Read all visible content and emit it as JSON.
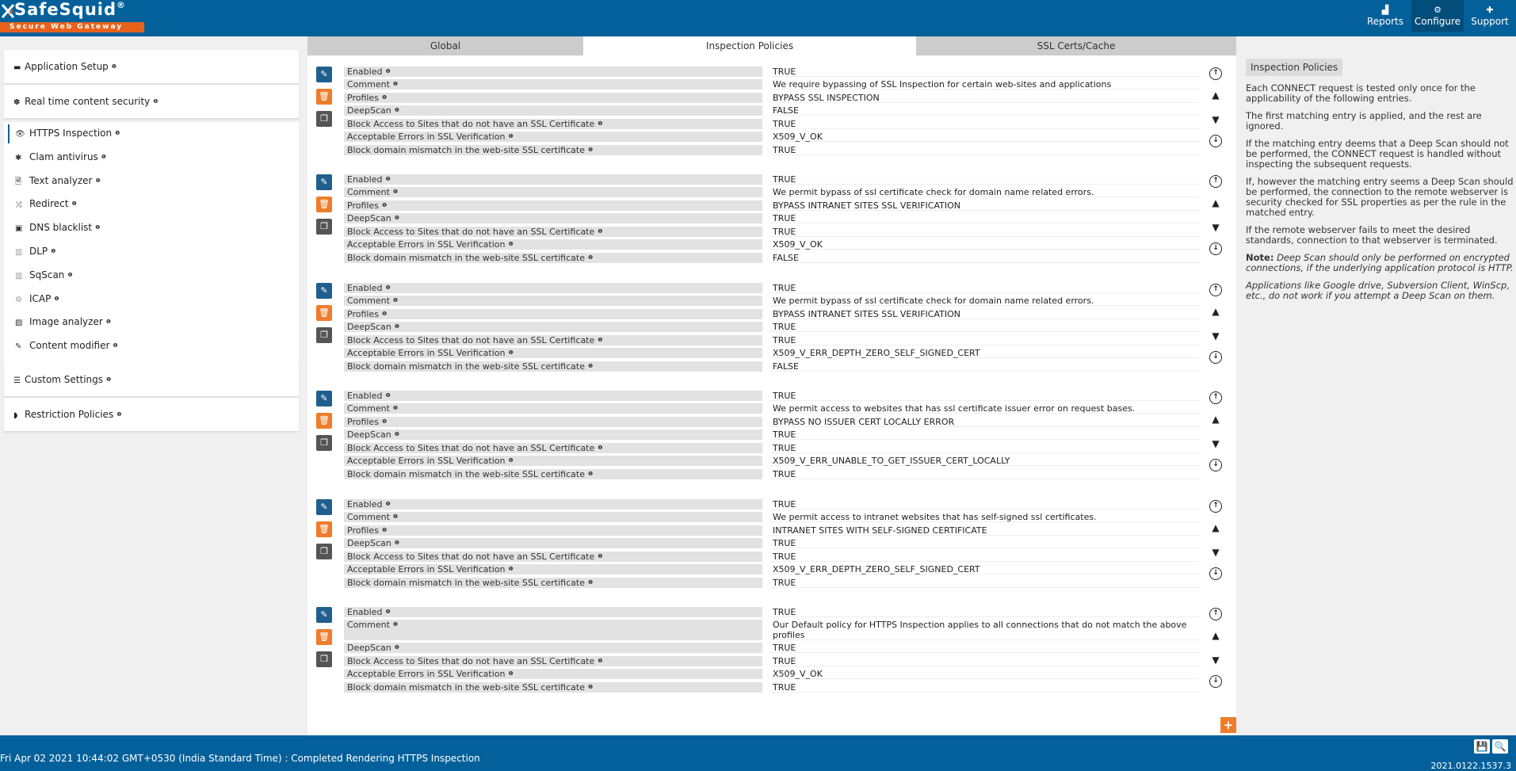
{
  "header": {
    "brand": "SafeSquid",
    "reg": "®",
    "tagline": "Secure Web Gateway",
    "nav": [
      {
        "label": "Reports",
        "icon": "reports-icon"
      },
      {
        "label": "Configure",
        "icon": "configure-icon"
      },
      {
        "label": "Support",
        "icon": "support-icon"
      }
    ]
  },
  "sidebar": {
    "app_setup": "Application Setup",
    "realtime": "Real time content security",
    "items": [
      {
        "label": "HTTPS Inspection",
        "glyph": "👁"
      },
      {
        "label": "Clam antivirus",
        "glyph": "✱"
      },
      {
        "label": "Text analyzer",
        "glyph": "🗎"
      },
      {
        "label": "Redirect",
        "glyph": "⤨"
      },
      {
        "label": "DNS blacklist",
        "glyph": "▣"
      },
      {
        "label": "DLP",
        "glyph": "▥"
      },
      {
        "label": "SqScan",
        "glyph": "▥"
      },
      {
        "label": "ICAP",
        "glyph": "⚙"
      },
      {
        "label": "Image analyzer",
        "glyph": "▨"
      },
      {
        "label": "Content modifier",
        "glyph": "✎"
      }
    ],
    "custom": "Custom Settings",
    "restriction": "Restriction Policies"
  },
  "tabs": [
    "Global",
    "Inspection Policies",
    "SSL Certs/Cache"
  ],
  "labels": {
    "enabled": "Enabled",
    "comment": "Comment",
    "profiles": "Profiles",
    "deepscan": "DeepScan",
    "block_no_ssl": "Block Access to Sites that do not have an SSL Certificate",
    "acceptable": "Acceptable Errors in SSL Verification",
    "mismatch": "Block domain mismatch in the web-site SSL certificate"
  },
  "entries": [
    {
      "enabled": "TRUE",
      "comment": "We require bypassing of SSL Inspection for certain web-sites and applications",
      "profiles": "BYPASS SSL INSPECTION",
      "deepscan": "FALSE",
      "block_no_ssl": "TRUE",
      "acceptable": "X509_V_OK",
      "mismatch": "TRUE"
    },
    {
      "enabled": "TRUE",
      "comment": "We permit bypass of ssl certificate check for domain name related errors.",
      "profiles": "BYPASS INTRANET SITES SSL VERIFICATION",
      "deepscan": "TRUE",
      "block_no_ssl": "TRUE",
      "acceptable": "X509_V_OK",
      "mismatch": "FALSE"
    },
    {
      "enabled": "TRUE",
      "comment": "We permit bypass of ssl certificate check for domain name related errors.",
      "profiles": "BYPASS INTRANET SITES SSL VERIFICATION",
      "deepscan": "TRUE",
      "block_no_ssl": "TRUE",
      "acceptable": "X509_V_ERR_DEPTH_ZERO_SELF_SIGNED_CERT",
      "mismatch": "FALSE"
    },
    {
      "enabled": "TRUE",
      "comment": "We permit access to websites that has ssl certificate issuer error on request bases.",
      "profiles": "BYPASS NO ISSUER CERT LOCALLY ERROR",
      "deepscan": "TRUE",
      "block_no_ssl": "TRUE",
      "acceptable": "X509_V_ERR_UNABLE_TO_GET_ISSUER_CERT_LOCALLY",
      "mismatch": "TRUE"
    },
    {
      "enabled": "TRUE",
      "comment": "We permit access to intranet websites that has self-signed ssl certificates.",
      "profiles": "INTRANET SITES WITH SELF-SIGNED CERTIFICATE",
      "deepscan": "TRUE",
      "block_no_ssl": "TRUE",
      "acceptable": "X509_V_ERR_DEPTH_ZERO_SELF_SIGNED_CERT",
      "mismatch": "TRUE"
    },
    {
      "enabled": "TRUE",
      "comment": "Our Default policy for HTTPS Inspection applies to all connections that do not match the above profiles",
      "deepscan": "TRUE",
      "block_no_ssl": "TRUE",
      "acceptable": "X509_V_OK",
      "mismatch": "TRUE"
    }
  ],
  "info": {
    "title": "Inspection Policies",
    "p1": "Each CONNECT request is tested only once for the applicability of the following entries.",
    "p2": "The first matching entry is applied, and the rest are ignored.",
    "p3": "If the matching entry deems that a Deep Scan should not be performed, the CONNECT request is handled without inspecting the subsequent requests.",
    "p4": "If, however the matching entry seems a Deep Scan should be performed, the connection to the remote webserver is security checked for SSL properties as per the rule in the matched entry.",
    "p5": "If the remote webserver fails to meet the desired standards, connection to that webserver is terminated.",
    "note_label": "Note:",
    "p6": "Deep Scan should only be performed on encrypted connections, if the underlying application protocol is HTTP.",
    "p7": "Applications like Google drive, Subversion Client, WinScp, etc., do not work if you attempt a Deep Scan on them."
  },
  "status": {
    "message": "Fri Apr 02 2021 10:44:02 GMT+0530 (India Standard Time) : Completed Rendering HTTPS Inspection",
    "version": "2021.0122.1537.3"
  },
  "colors": {
    "primary": "#04609a",
    "accent": "#ee7d2b",
    "edit": "#1f5f8e"
  }
}
